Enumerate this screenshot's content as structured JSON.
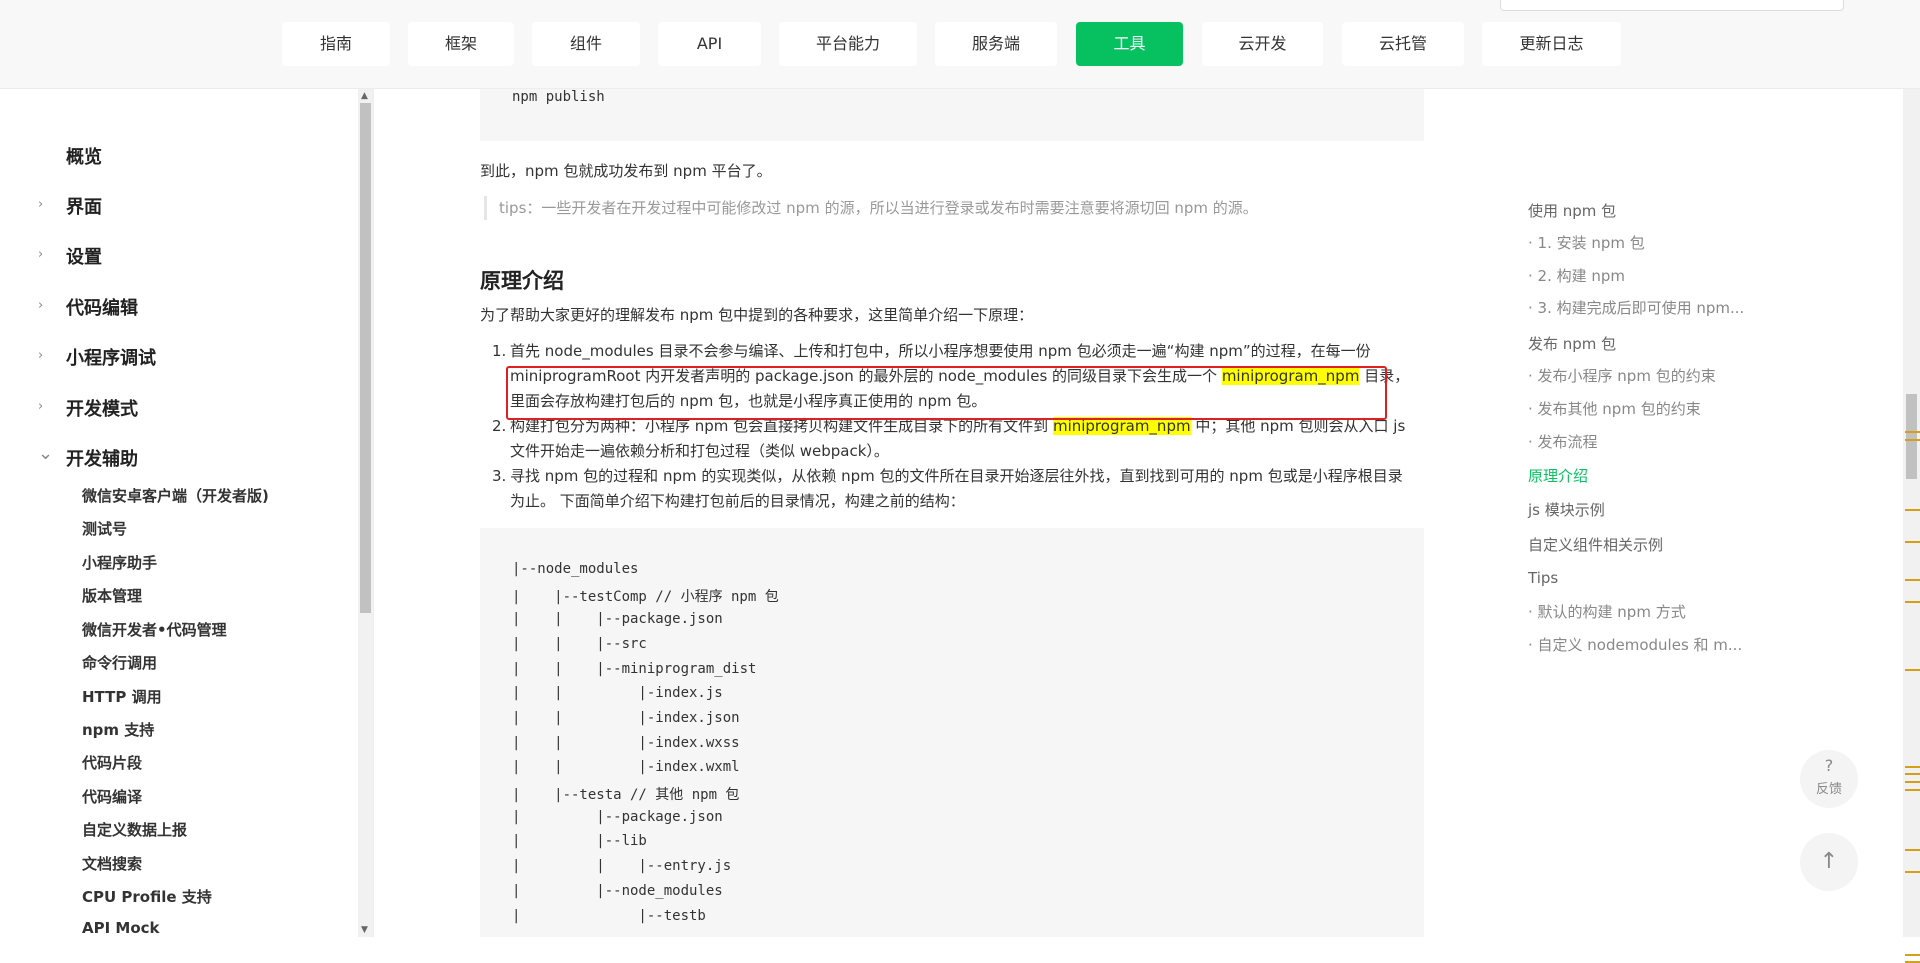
{
  "topnav": {
    "tabs": [
      "指南",
      "框架",
      "组件",
      "API",
      "平台能力",
      "服务端",
      "工具",
      "云开发",
      "云托管",
      "更新日志"
    ],
    "active": "工具"
  },
  "sidebar": {
    "groups": [
      {
        "label": "概览",
        "chevron": ""
      },
      {
        "label": "界面",
        "chevron": "›"
      },
      {
        "label": "设置",
        "chevron": "›"
      },
      {
        "label": "代码编辑",
        "chevron": "›"
      },
      {
        "label": "小程序调试",
        "chevron": "›"
      },
      {
        "label": "开发模式",
        "chevron": "›"
      },
      {
        "label": "开发辅助",
        "chevron": "⌄"
      }
    ],
    "subitems": [
      "微信安卓客户端（开发者版)",
      "测试号",
      "小程序助手",
      "版本管理",
      "微信开发者•代码管理",
      "命令行调用",
      "HTTP 调用",
      "npm 支持",
      "代码片段",
      "代码编译",
      "自定义数据上报",
      "文档搜索",
      "CPU Profile 支持",
      "API Mock"
    ]
  },
  "content": {
    "top_code": "npm publish",
    "published_text": "到此，npm 包就成功发布到 npm 平台了。",
    "tips": "tips：一些开发者在开发过程中可能修改过 npm 的源，所以当进行登录或发布时需要注意要将源切回 npm 的源。",
    "heading": "原理介绍",
    "intro": "为了帮助大家更好的理解发布 npm 包中提到的各种要求，这里简单介绍一下原理：",
    "list": {
      "item1_line1": "首先 node_modules 目录不会参与编译、上传和打包中，所以小程序想要使用 npm 包必须走一遍“构建 npm”的过程，在每一份",
      "item1_line2a": "miniprogramRoot 内开发者声明的 package.json 的最外层的 node_modules 的同级目录下会生成一个 ",
      "item1_hl": "miniprogram_npm",
      "item1_line2b": " 目录，",
      "item1_line3": "里面会存放构建打包后的 npm 包，也就是小程序真正使用的 npm 包。",
      "item2_line1a": "构建打包分为两种：小程序 npm 包会直接拷贝构建文件生成目录下的所有文件到 ",
      "item2_hl": "miniprogram_npm",
      "item2_line1b": " 中；其他 npm 包则会从入口 js",
      "item2_line2": "文件开始走一遍依赖分析和打包过程（类似 webpack）。",
      "item3_line1": "寻找 npm 包的过程和 npm 的实现类似，从依赖 npm 包的文件所在目录开始逐层往外找，直到找到可用的 npm 包或是小程序根目录",
      "item3_line2": "为止。 下面简单介绍下构建打包前后的目录情况，构建之前的结构："
    },
    "tree": [
      "|--node_modules",
      "|    |--testComp // 小程序 npm 包",
      "|    |    |--package.json",
      "|    |    |--src",
      "|    |    |--miniprogram_dist",
      "|    |         |-index.js",
      "|    |         |-index.json",
      "|    |         |-index.wxss",
      "|    |         |-index.wxml",
      "|    |--testa // 其他 npm 包",
      "|         |--package.json",
      "|         |--lib",
      "|         |    |--entry.js",
      "|         |--node_modules",
      "|              |--testb"
    ]
  },
  "toc": {
    "items": [
      {
        "label": "使用 npm 包",
        "kind": "h"
      },
      {
        "label": "· 1. 安装 npm 包",
        "kind": "sub"
      },
      {
        "label": "· 2. 构建 npm",
        "kind": "sub"
      },
      {
        "label": "· 3. 构建完成后即可使用 npm...",
        "kind": "sub"
      },
      {
        "label": "发布 npm 包",
        "kind": "h"
      },
      {
        "label": "· 发布小程序 npm 包的约束",
        "kind": "sub"
      },
      {
        "label": "· 发布其他 npm 包的约束",
        "kind": "sub"
      },
      {
        "label": "· 发布流程",
        "kind": "sub"
      },
      {
        "label": "原理介绍",
        "kind": "active"
      },
      {
        "label": "js 模块示例",
        "kind": "h"
      },
      {
        "label": "自定义组件相关示例",
        "kind": "h"
      },
      {
        "label": "Tips",
        "kind": "h"
      },
      {
        "label": "· 默认的构建 npm 方式",
        "kind": "sub"
      },
      {
        "label": "· 自定义 nodemodules 和 m...",
        "kind": "sub"
      }
    ]
  },
  "float": {
    "feedback_icon": "?",
    "feedback_label": "反馈",
    "top_icon": "↑"
  },
  "colors": {
    "accent": "#07c160",
    "highlight": "#ffff00",
    "annotation": "#e02020"
  }
}
